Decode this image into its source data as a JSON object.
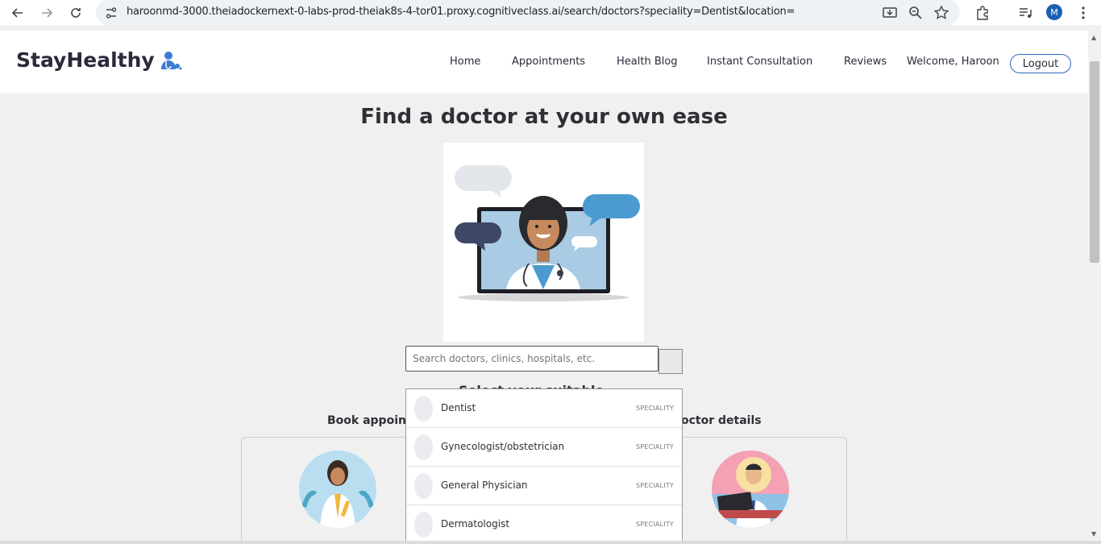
{
  "browser": {
    "url": "haroonmd-3000.theiadockernext-0-labs-prod-theiak8s-4-tor01.proxy.cognitiveclass.ai/search/doctors?speciality=Dentist&location=",
    "profile_initial": "M"
  },
  "header": {
    "logo_text": "StayHealthy",
    "nav": [
      "Home",
      "Appointments",
      "Health Blog",
      "Instant Consultation",
      "Reviews"
    ],
    "welcome": "Welcome, Haroon",
    "logout_label": "Logout"
  },
  "hero": {
    "title": "Find a doctor at your own ease"
  },
  "search": {
    "placeholder": "Search doctors, clinics, hospitals, etc."
  },
  "dropdown": {
    "items": [
      {
        "label": "Dentist",
        "type": "SPECIALITY"
      },
      {
        "label": "Gynecologist/obstetrician",
        "type": "SPECIALITY"
      },
      {
        "label": "General Physician",
        "type": "SPECIALITY"
      },
      {
        "label": "Dermatologist",
        "type": "SPECIALITY"
      }
    ]
  },
  "sections": {
    "partial_subtitle": "Select your suitable",
    "left_label": "Book appoin",
    "right_label": "octor details"
  },
  "colors": {
    "accent": "#2a6cc0",
    "background": "#f0f0f0",
    "text": "#2f2f36"
  }
}
